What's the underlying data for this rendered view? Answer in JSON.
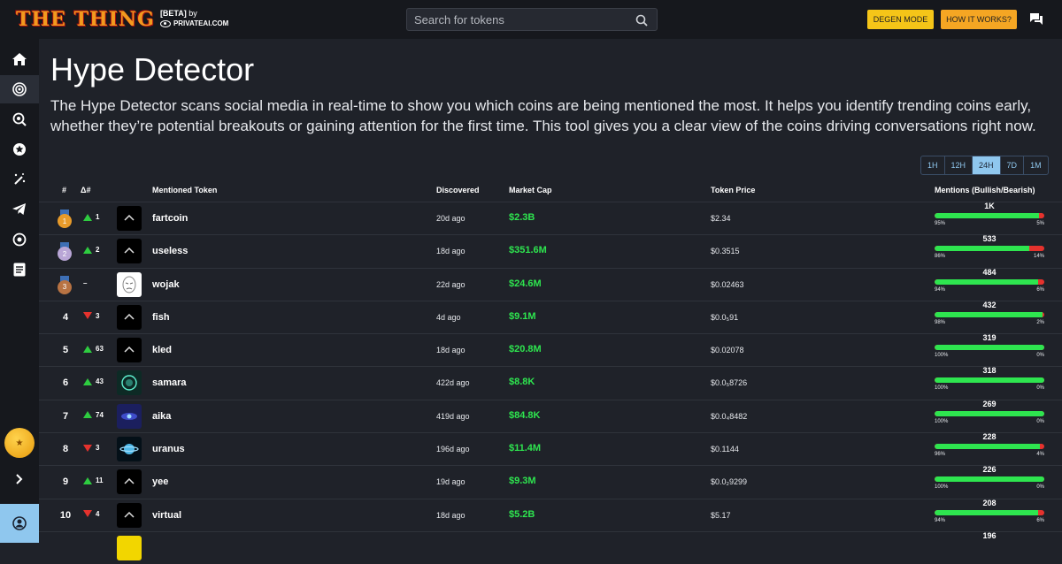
{
  "header": {
    "logo_text": "THE THING",
    "beta_text": "[BETA]",
    "by_text": "by",
    "partner": "PRIVATEAI.COM",
    "search_placeholder": "Search for tokens",
    "degen_button": "DEGEN MODE",
    "how_button": "HOW IT WORKS?"
  },
  "sidebar": {
    "items": [
      {
        "icon": "home-icon"
      },
      {
        "icon": "target-icon",
        "active": true
      },
      {
        "icon": "search-globe-icon"
      },
      {
        "icon": "star-icon"
      },
      {
        "icon": "magic-icon"
      },
      {
        "icon": "telegram-icon"
      },
      {
        "icon": "radar-icon"
      },
      {
        "icon": "document-icon"
      }
    ],
    "expand_icon": "chevron-right-icon",
    "account_icon": "account-icon"
  },
  "page": {
    "title": "Hype Detector",
    "description": "The Hype Detector scans social media in real-time to show you which coins are being mentioned the most. It helps you identify trending coins early, whether they’re potential breakouts or gaining attention for the first time. This tool gives you a clear view of the coins driving conversations right now."
  },
  "timeframes": [
    {
      "label": "1H",
      "active": false
    },
    {
      "label": "12H",
      "active": false
    },
    {
      "label": "24H",
      "active": true
    },
    {
      "label": "7D",
      "active": false
    },
    {
      "label": "1M",
      "active": false
    }
  ],
  "table": {
    "headers": {
      "rank": "#",
      "delta": "Δ#",
      "token": "Mentioned Token",
      "discovered": "Discovered",
      "market_cap": "Market Cap",
      "price": "Token Price",
      "mentions": "Mentions (Bullish/Bearish)"
    },
    "rows": [
      {
        "rank": "1",
        "medal": "gold",
        "delta_dir": "up",
        "delta": "1",
        "name": "fartcoin",
        "discovered": "20d ago",
        "market_cap": "$2.3B",
        "price": "$2.34",
        "mentions": "1K",
        "bull_pct": 95,
        "bull": "95%",
        "bear": "5%",
        "logo": "black"
      },
      {
        "rank": "2",
        "medal": "silver",
        "delta_dir": "up",
        "delta": "2",
        "name": "useless",
        "discovered": "18d ago",
        "market_cap": "$351.6M",
        "price": "$0.3515",
        "mentions": "533",
        "bull_pct": 86,
        "bull": "86%",
        "bear": "14%",
        "logo": "black"
      },
      {
        "rank": "3",
        "medal": "bronze",
        "delta_dir": "none",
        "delta": "–",
        "name": "wojak",
        "discovered": "22d ago",
        "market_cap": "$24.6M",
        "price": "$0.02463",
        "mentions": "484",
        "bull_pct": 94,
        "bull": "94%",
        "bear": "6%",
        "logo": "white"
      },
      {
        "rank": "4",
        "medal": "",
        "delta_dir": "down",
        "delta": "3",
        "name": "fish",
        "discovered": "4d ago",
        "market_cap": "$9.1M",
        "price": "$0.0₅91",
        "mentions": "432",
        "bull_pct": 98,
        "bull": "98%",
        "bear": "2%",
        "logo": "black"
      },
      {
        "rank": "5",
        "medal": "",
        "delta_dir": "up",
        "delta": "63",
        "name": "kled",
        "discovered": "18d ago",
        "market_cap": "$20.8M",
        "price": "$0.02078",
        "mentions": "319",
        "bull_pct": 100,
        "bull": "100%",
        "bear": "0%",
        "logo": "black"
      },
      {
        "rank": "6",
        "medal": "",
        "delta_dir": "up",
        "delta": "43",
        "name": "samara",
        "discovered": "422d ago",
        "market_cap": "$8.8K",
        "price": "$0.0₅8726",
        "mentions": "318",
        "bull_pct": 100,
        "bull": "100%",
        "bear": "0%",
        "logo": "green"
      },
      {
        "rank": "7",
        "medal": "",
        "delta_dir": "up",
        "delta": "74",
        "name": "aika",
        "discovered": "419d ago",
        "market_cap": "$84.8K",
        "price": "$0.0₄8482",
        "mentions": "269",
        "bull_pct": 100,
        "bull": "100%",
        "bear": "0%",
        "logo": "blue"
      },
      {
        "rank": "8",
        "medal": "",
        "delta_dir": "down",
        "delta": "3",
        "name": "uranus",
        "discovered": "196d ago",
        "market_cap": "$11.4M",
        "price": "$0.1144",
        "mentions": "228",
        "bull_pct": 96,
        "bull": "96%",
        "bear": "4%",
        "logo": "planet"
      },
      {
        "rank": "9",
        "medal": "",
        "delta_dir": "up",
        "delta": "11",
        "name": "yee",
        "discovered": "19d ago",
        "market_cap": "$9.3M",
        "price": "$0.0₂9299",
        "mentions": "226",
        "bull_pct": 100,
        "bull": "100%",
        "bear": "0%",
        "logo": "black"
      },
      {
        "rank": "10",
        "medal": "",
        "delta_dir": "down",
        "delta": "4",
        "name": "virtual",
        "discovered": "18d ago",
        "market_cap": "$5.2B",
        "price": "$5.17",
        "mentions": "208",
        "bull_pct": 94,
        "bull": "94%",
        "bear": "6%",
        "logo": "black"
      },
      {
        "rank": "",
        "medal": "",
        "delta_dir": "none",
        "delta": "",
        "name": "",
        "discovered": "",
        "market_cap": "",
        "price": "",
        "mentions": "196",
        "bull_pct": null,
        "bull": "",
        "bear": "",
        "logo": "gold"
      }
    ]
  },
  "colors": {
    "accent_blue": "#8fc7ee",
    "bullish": "#2ee54f",
    "bearish": "#e5322d",
    "degen": "#f5c518",
    "how": "#f5a623"
  }
}
